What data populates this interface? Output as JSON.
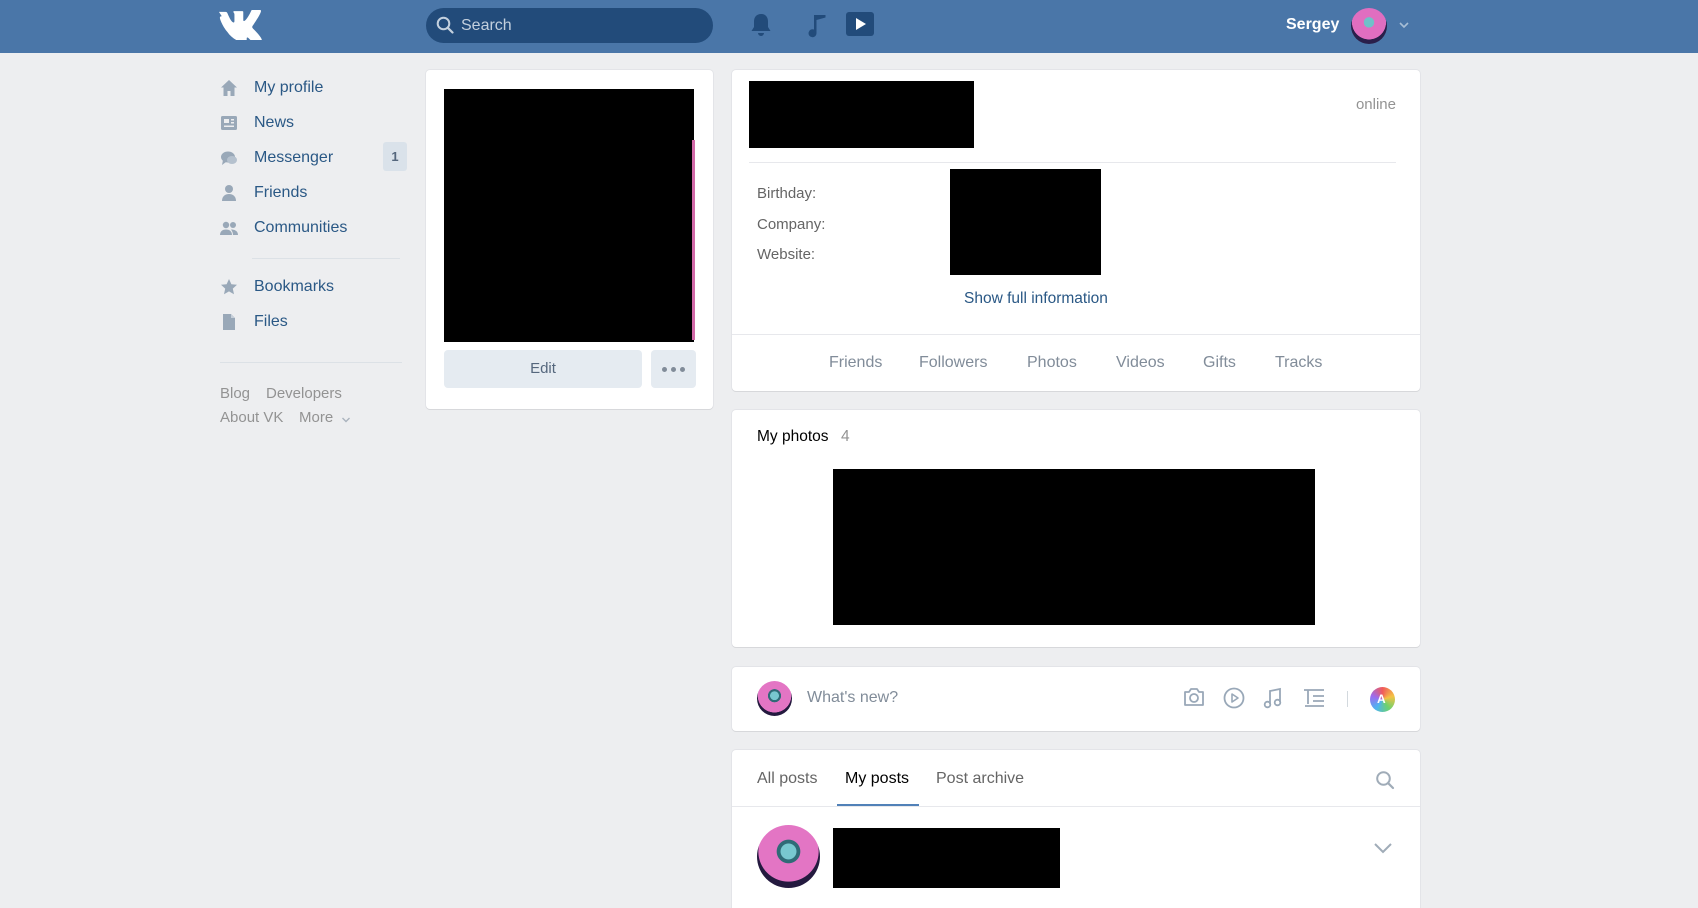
{
  "header": {
    "logo": "VK",
    "search_placeholder": "Search",
    "user_name": "Sergey",
    "icons": [
      "vk-logo",
      "search-icon",
      "bell-icon",
      "music-note-icon",
      "video-play-icon",
      "avatar",
      "chevron-down-icon"
    ]
  },
  "sidebar": {
    "items": [
      {
        "label": "My profile",
        "icon": "home-icon"
      },
      {
        "label": "News",
        "icon": "newspaper-icon"
      },
      {
        "label": "Messenger",
        "icon": "chat-icon",
        "badge": "1"
      },
      {
        "label": "Friends",
        "icon": "person-icon"
      },
      {
        "label": "Communities",
        "icon": "people-icon"
      },
      {
        "label": "Bookmarks",
        "icon": "star-icon"
      },
      {
        "label": "Files",
        "icon": "file-icon"
      }
    ],
    "footer": {
      "blog": "Blog",
      "developers": "Developers",
      "about": "About VK",
      "more": "More"
    }
  },
  "profile_card": {
    "edit_label": "Edit"
  },
  "info_card": {
    "status": "online",
    "fields": [
      {
        "label": "Birthday:"
      },
      {
        "label": "Company:"
      },
      {
        "label": "Website:"
      }
    ],
    "show_full": "Show full information",
    "counters": [
      "Friends",
      "Followers",
      "Photos",
      "Videos",
      "Gifts",
      "Tracks"
    ]
  },
  "photos_card": {
    "title": "My photos",
    "count": "4"
  },
  "composer": {
    "placeholder": "What's new?"
  },
  "wall": {
    "tabs": [
      "All posts",
      "My posts",
      "Post archive"
    ],
    "active_tab": "My posts"
  },
  "colors": {
    "topbar": "#4a76a8",
    "link": "#2a5885",
    "background": "#edeef0",
    "accent": "#5181b8"
  }
}
